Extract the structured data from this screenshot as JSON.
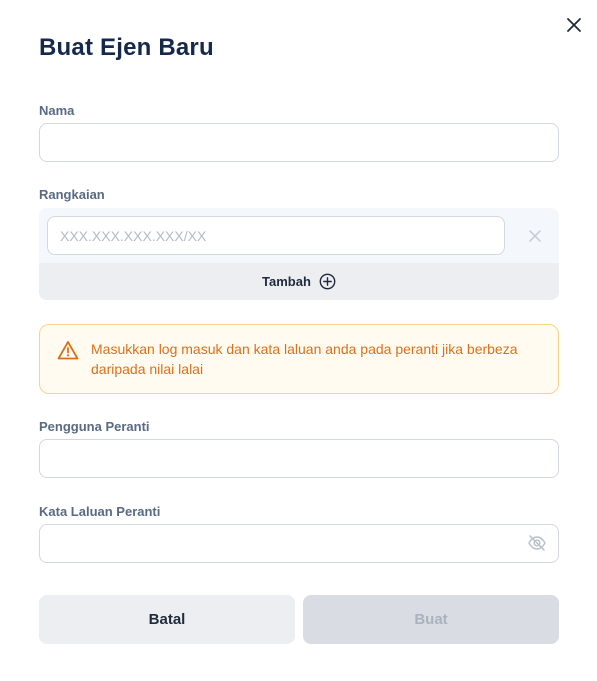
{
  "dialog": {
    "title": "Buat Ejen Baru",
    "close_icon": "close-icon"
  },
  "fields": {
    "name": {
      "label": "Nama",
      "value": "",
      "placeholder": ""
    },
    "range": {
      "label": "Rangkaian",
      "value": "",
      "placeholder": "XXX.XXX.XXX.XXX/XX",
      "clear_icon": "close-icon",
      "add_label": "Tambah",
      "add_icon": "plus-circle-icon"
    },
    "device_user": {
      "label": "Pengguna Peranti",
      "value": "",
      "placeholder": ""
    },
    "device_password": {
      "label": "Kata Laluan Peranti",
      "value": "",
      "placeholder": "",
      "toggle_icon": "eye-off-icon"
    }
  },
  "alert": {
    "icon": "warning-triangle-icon",
    "text": "Masukkan log masuk dan kata laluan anda pada peranti jika berbeza daripada nilai lalai",
    "color": "#d9701d"
  },
  "actions": {
    "cancel_label": "Batal",
    "create_label": "Buat"
  },
  "colors": {
    "title": "#15294b",
    "label": "#596a82",
    "warning_border": "#f6d48a",
    "warning_bg": "#fffbf0"
  }
}
